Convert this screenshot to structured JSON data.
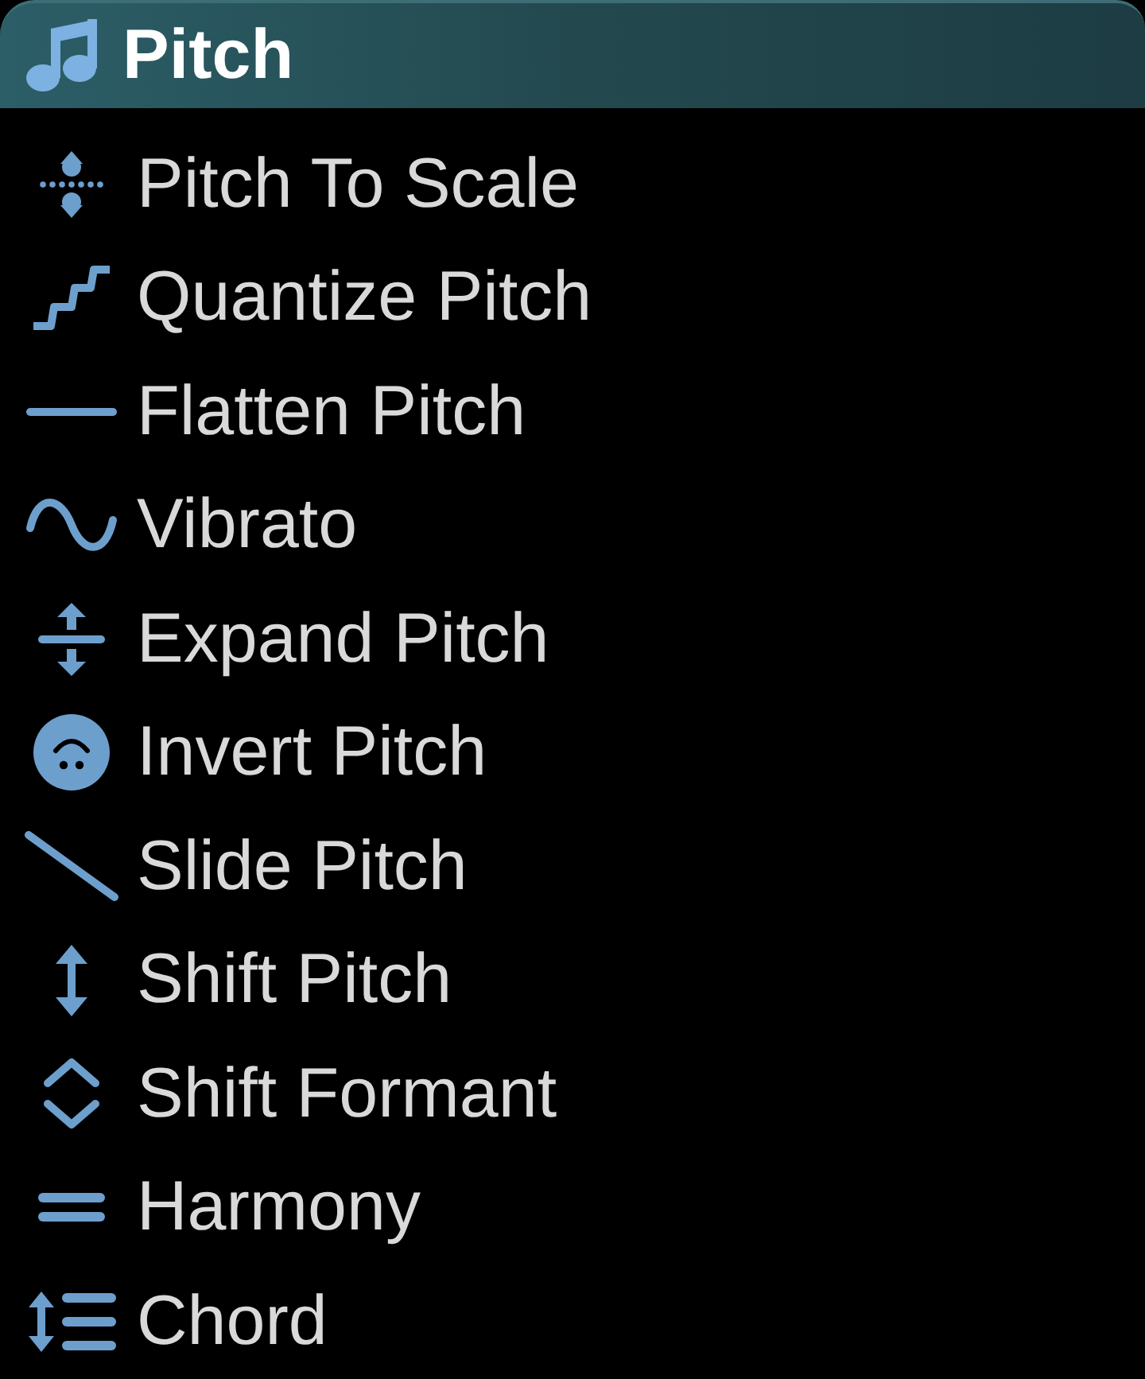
{
  "header": {
    "title": "Pitch"
  },
  "items": [
    {
      "label": "Pitch To Scale"
    },
    {
      "label": "Quantize Pitch"
    },
    {
      "label": "Flatten Pitch"
    },
    {
      "label": "Vibrato"
    },
    {
      "label": "Expand Pitch"
    },
    {
      "label": "Invert Pitch"
    },
    {
      "label": "Slide Pitch"
    },
    {
      "label": "Shift Pitch"
    },
    {
      "label": "Shift Formant"
    },
    {
      "label": "Harmony"
    },
    {
      "label": "Chord"
    }
  ]
}
